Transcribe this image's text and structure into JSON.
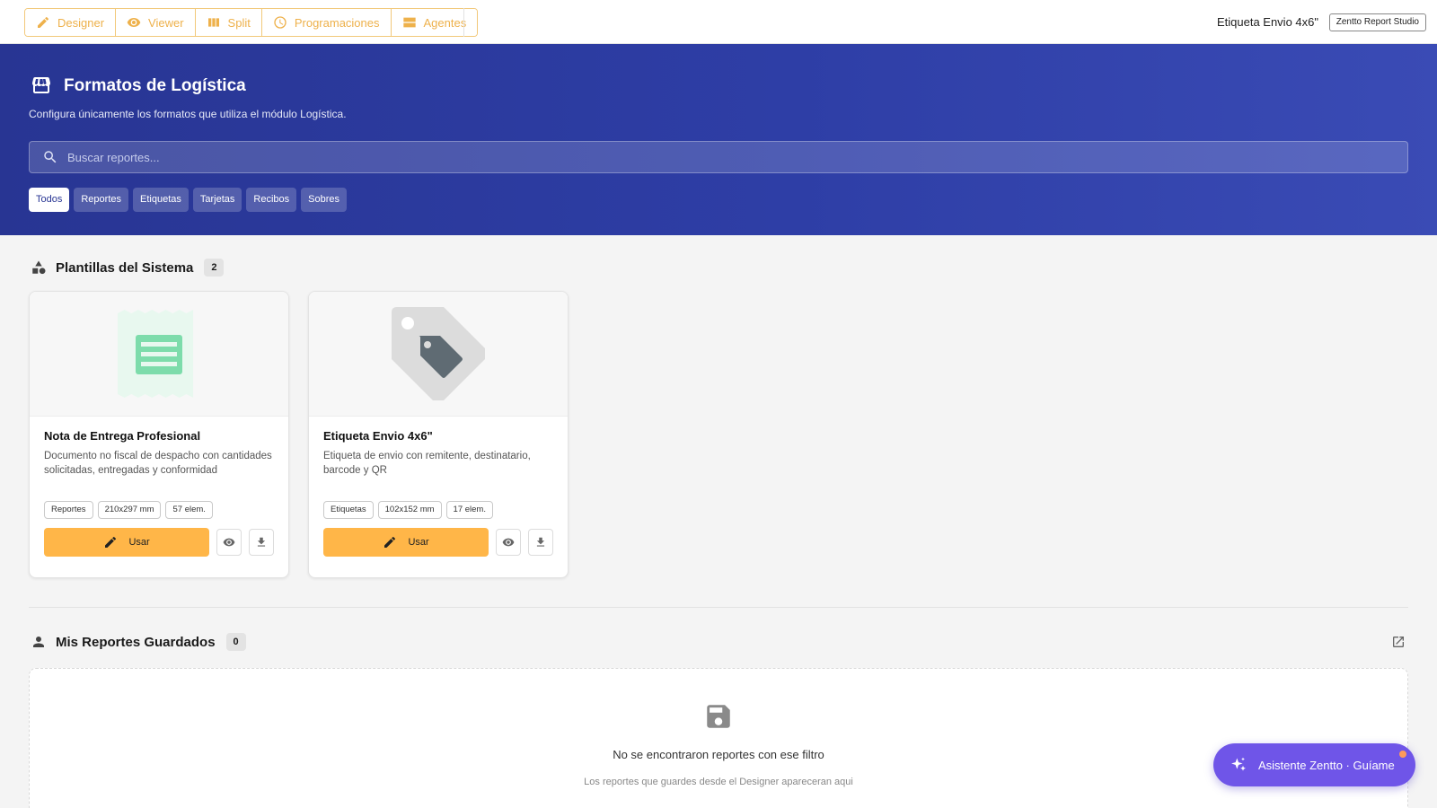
{
  "toolbar": {
    "modes": [
      {
        "label": "Designer",
        "icon": "pencil-icon"
      },
      {
        "label": "Viewer",
        "icon": "eye-icon"
      },
      {
        "label": "Split",
        "icon": "columns-icon"
      },
      {
        "label": "Programaciones",
        "icon": "clock-icon"
      },
      {
        "label": "Agentes",
        "icon": "agents-icon"
      }
    ],
    "document_title": "Etiqueta Envio 4x6\"",
    "studio_badge": "Zentto Report Studio"
  },
  "hero": {
    "icon": "store-icon",
    "title": "Formatos de Logística",
    "subtitle": "Configura únicamente los formatos que utiliza el módulo Logística.",
    "search_placeholder": "Buscar reportes...",
    "filters": [
      "Todos",
      "Reportes",
      "Etiquetas",
      "Tarjetas",
      "Recibos",
      "Sobres"
    ],
    "active_filter": "Todos"
  },
  "system_templates": {
    "title": "Plantillas del Sistema",
    "count": "2",
    "cards": [
      {
        "preview_icon": "receipt-icon",
        "title": "Nota de Entrega Profesional",
        "description": "Documento no fiscal de despacho con cantidades solicitadas, entregadas y conformidad",
        "tags": [
          "Reportes",
          "210x297 mm",
          "57 elem."
        ],
        "use_label": "Usar"
      },
      {
        "preview_icon": "tag-icon",
        "title": "Etiqueta Envio 4x6\"",
        "description": "Etiqueta de envio con remitente, destinatario, barcode y QR",
        "tags": [
          "Etiquetas",
          "102x152 mm",
          "17 elem."
        ],
        "use_label": "Usar"
      }
    ]
  },
  "saved_reports": {
    "title": "Mis Reportes Guardados",
    "count": "0",
    "empty_title": "No se encontraron reportes con ese filtro",
    "empty_subtitle": "Los reportes que guardes desde el Designer apareceran aqui"
  },
  "assistant": {
    "label": "Asistente Zentto · Guíame"
  },
  "colors": {
    "accent": "#ffb648",
    "hero": "#283593",
    "assistant": "#6f55e8",
    "receipt_green": "#7ddcab",
    "tag_gray": "#5f6b73"
  }
}
